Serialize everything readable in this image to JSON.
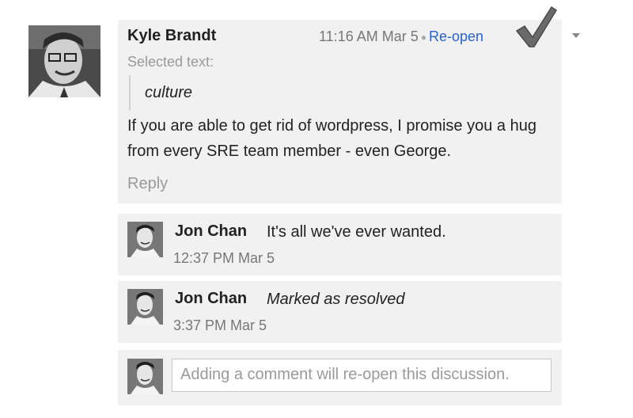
{
  "comment": {
    "author": "Kyle Brandt",
    "timestamp": "11:16 AM Mar 5",
    "reopen_label": "Re-open",
    "selected_label": "Selected text:",
    "selected_text": "culture",
    "body": "If you are able to get rid of wordpress, I promise you a hug from every SRE team member - even George.",
    "reply_label": "Reply"
  },
  "replies": [
    {
      "author": "Jon Chan",
      "message": "It's all we've ever wanted.",
      "time": "12:37 PM Mar 5"
    },
    {
      "author": "Jon Chan",
      "message": "Marked as resolved",
      "time": "3:37 PM Mar 5"
    }
  ],
  "composer": {
    "placeholder": "Adding a comment will re-open this discussion."
  },
  "colors": {
    "card_bg": "#f1f1f1",
    "link": "#2a62c9",
    "muted": "#9a9a9a",
    "check": "#5d5d5d"
  },
  "icons": {
    "resolved": "checkmark-icon",
    "menu": "caret-down-icon"
  }
}
